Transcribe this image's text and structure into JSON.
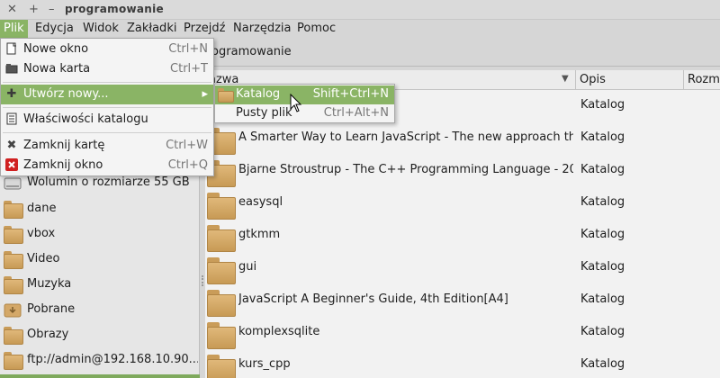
{
  "window": {
    "title": "programowanie",
    "close_glyph": "✕",
    "maximize_glyph": "+",
    "minimize_glyph": "–"
  },
  "menubar": {
    "items": [
      "Plik",
      "Edycja",
      "Widok",
      "Zakładki",
      "Przejdź",
      "Narzędzia",
      "Pomoc"
    ],
    "active": "Plik"
  },
  "location": {
    "path_segment": "rogramowanie"
  },
  "columns": {
    "name": "azwa",
    "desc": "Opis",
    "size": "Rozmi"
  },
  "sidebar": {
    "items": [
      {
        "label": "Wolumin o rozmiarze 55 GB",
        "icon": "drive-icon"
      },
      {
        "label": "dane",
        "icon": "folder-icon"
      },
      {
        "label": "vbox",
        "icon": "folder-icon"
      },
      {
        "label": "Video",
        "icon": "folder-icon"
      },
      {
        "label": "Muzyka",
        "icon": "folder-icon"
      },
      {
        "label": "Pobrane",
        "icon": "download-folder-icon"
      },
      {
        "label": "Obrazy",
        "icon": "folder-icon"
      },
      {
        "label": "ftp://admin@192.168.10.90...",
        "icon": "network-folder-icon"
      }
    ]
  },
  "files": [
    {
      "name": "",
      "desc": "Katalog"
    },
    {
      "name": "A Smarter Way to Learn JavaScript - The new approach th...",
      "desc": "Katalog"
    },
    {
      "name": "Bjarne Stroustrup - The C++ Programming Language - 20...",
      "desc": "Katalog"
    },
    {
      "name": "easysql",
      "desc": "Katalog"
    },
    {
      "name": "gtkmm",
      "desc": "Katalog"
    },
    {
      "name": "gui",
      "desc": "Katalog"
    },
    {
      "name": "JavaScript A Beginner's Guide, 4th Edition[A4]",
      "desc": "Katalog"
    },
    {
      "name": "komplexsqlite",
      "desc": "Katalog"
    },
    {
      "name": "kurs_cpp",
      "desc": "Katalog"
    }
  ],
  "file_menu": {
    "items": [
      {
        "label": "Nowe okno",
        "shortcut": "Ctrl+N",
        "icon": "new-window-icon"
      },
      {
        "label": "Nowa karta",
        "shortcut": "Ctrl+T",
        "icon": "new-tab-icon"
      },
      {
        "label": "Utwórz nowy...",
        "shortcut": "",
        "icon": "add-icon",
        "submenu_arrow": "▸"
      },
      {
        "label": "Właściwości katalogu",
        "shortcut": "",
        "icon": "properties-icon"
      },
      {
        "label": "Zamknij kartę",
        "shortcut": "Ctrl+W",
        "icon": "close-tab-icon"
      },
      {
        "label": "Zamknij okno",
        "shortcut": "Ctrl+Q",
        "icon": "close-window-icon"
      }
    ]
  },
  "create_submenu": {
    "items": [
      {
        "label": "Katalog",
        "shortcut": "Shift+Ctrl+N",
        "icon": "folder-icon"
      },
      {
        "label": "Pusty plik",
        "shortcut": "Ctrl+Alt+N",
        "icon": ""
      }
    ]
  },
  "colors": {
    "accent": "#8ab465",
    "folder": "#d4a868"
  }
}
